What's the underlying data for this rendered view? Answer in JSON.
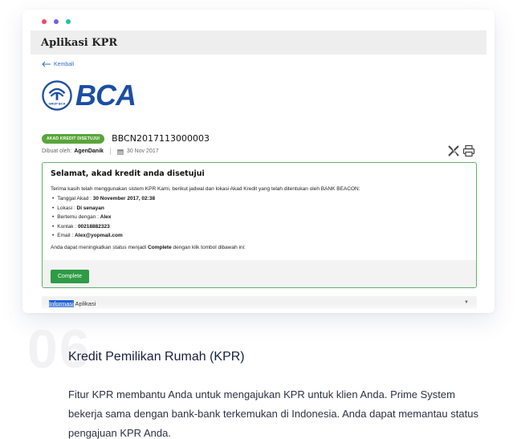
{
  "window": {
    "dot_colors": [
      "#ea4d5f",
      "#6c64e0",
      "#20c2a0"
    ]
  },
  "app": {
    "title": "Aplikasi KPR",
    "back_label": "Kembali"
  },
  "bank": {
    "name": "BCA",
    "emblem_caption": "GRUP BCA",
    "brand_color": "#1b4ea3"
  },
  "application": {
    "status_badge": "AKAD KREDIT DISETUJUI",
    "reference": "BBCN2017113000003",
    "created_by_label": "Dibuat oleh:",
    "created_by": "AgenDanik",
    "date": "30 Nov 2017",
    "icons": [
      "excel-icon",
      "printer-icon"
    ]
  },
  "notice": {
    "title": "Selamat, akad kredit anda disetujui",
    "intro": "Terima kasih telah menggunakan sistem KPR Kami, berikut jadwal dan lokasi Akad Kredit yang telah ditentukan oleh BANK BEACON:",
    "details": [
      {
        "label": "Tanggal Akad : ",
        "value": "30 November 2017, 02:38"
      },
      {
        "label": "Lokasi : ",
        "value": "Di senayan"
      },
      {
        "label": "Bertemu dengan : ",
        "value": "Alex"
      },
      {
        "label": "Kontak : ",
        "value": "00218882323"
      },
      {
        "label": "Email : ",
        "value": "Alex@yopmail.com"
      }
    ],
    "footer_pre": "Anda dapat meningkatkan status menjadi ",
    "footer_bold": "Complete",
    "footer_post": " dengan klik tombol dibawah ini:",
    "button_label": "Complete",
    "accent_color": "#63b06a"
  },
  "info_tab": {
    "label_highlight": "Informasi",
    "label_rest": " Aplikasi"
  },
  "feature": {
    "number": "06",
    "title": "Kredit Pemilikan Rumah (KPR)",
    "description": "Fitur KPR membantu Anda untuk mengajukan KPR untuk klien Anda. Prime System bekerja sama dengan bank-bank terkemukan di Indonesia. Anda dapat memantau status pengajuan KPR Anda."
  }
}
